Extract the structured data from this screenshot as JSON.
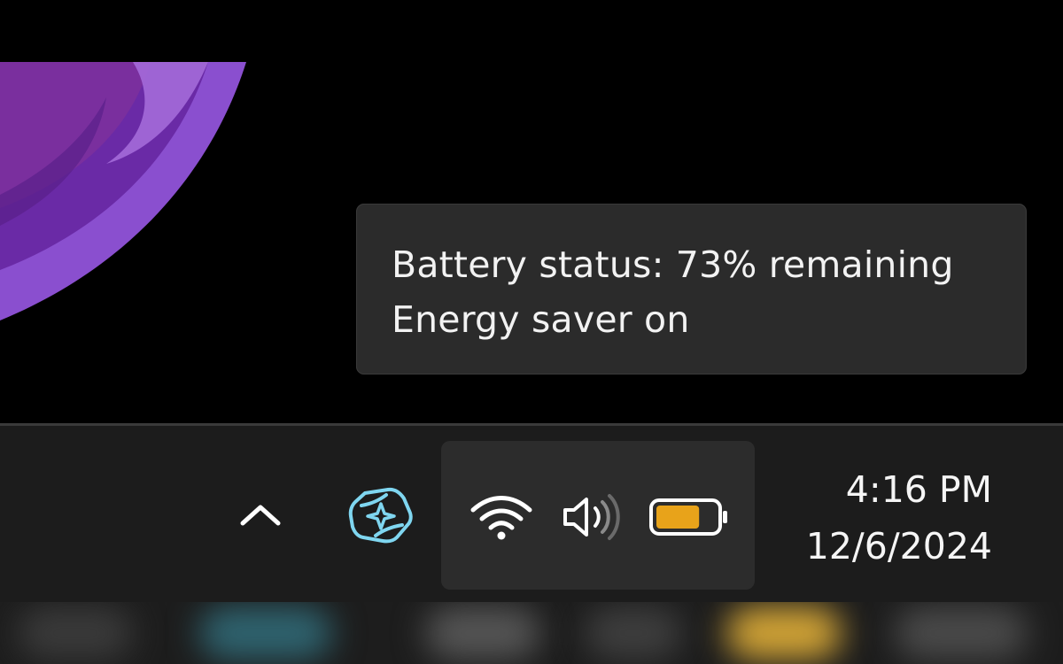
{
  "tooltip": {
    "line1": "Battery status: 73% remaining",
    "line2": "Energy saver on"
  },
  "tray": {
    "overflow_icon": "chevron-up-icon",
    "copilot_icon": "copilot-icon",
    "network_icon": "wifi-icon",
    "volume_icon": "volume-icon",
    "battery_icon": "battery-icon",
    "battery_level": 0.73
  },
  "clock": {
    "time": "4:16 PM",
    "date": "12/6/2024"
  },
  "colors": {
    "taskbar_bg": "#1c1c1c",
    "tooltip_bg": "#2b2b2b",
    "battery_fill": "#e8a31a",
    "copilot_accent": "#7fd6f0",
    "wallpaper_purple": "#9a5ad6"
  }
}
